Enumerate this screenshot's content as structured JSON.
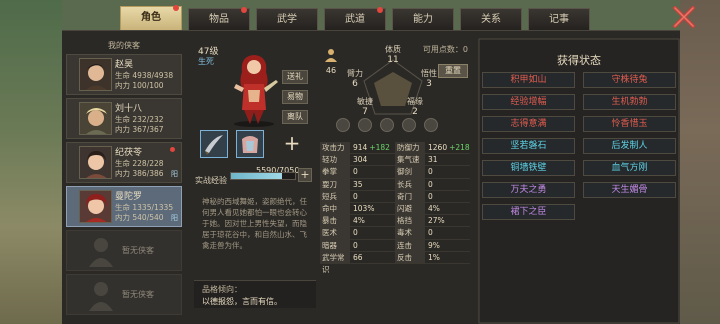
{
  "tabs": [
    {
      "label": "角色",
      "active": true,
      "badge": true
    },
    {
      "label": "物品",
      "active": false,
      "badge": true
    },
    {
      "label": "武学",
      "active": false,
      "badge": false
    },
    {
      "label": "武道",
      "active": false,
      "badge": true
    },
    {
      "label": "能力",
      "active": false,
      "badge": false
    },
    {
      "label": "关系",
      "active": false,
      "badge": false
    },
    {
      "label": "记事",
      "active": false,
      "badge": false
    }
  ],
  "character_list": {
    "title": "我的侠客",
    "characters": [
      {
        "name": "赵昊",
        "hp": "生命 4938/4938",
        "mp": "内力 100/100",
        "tag": ""
      },
      {
        "name": "刘十八",
        "hp": "生命 232/232",
        "mp": "内力 367/367",
        "tag": ""
      },
      {
        "name": "纪茯苓",
        "hp": "生命 228/228",
        "mp": "内力 386/386",
        "tag": "阳"
      },
      {
        "name": "曼陀罗",
        "hp": "生命 1335/1335",
        "mp": "内力 540/540",
        "tag": "阳"
      }
    ],
    "empty_slots": [
      "暂无侠客",
      "暂无侠客"
    ]
  },
  "profile": {
    "level": "47级",
    "gender": "生死",
    "buttons": [
      "送礼",
      "易物",
      "离队"
    ],
    "exp_label": "实战经验",
    "exp_value": "5590/7050",
    "exp_progress": 0.793,
    "exp_plus": "+",
    "equip_plus": "+",
    "bio": "神秘的西域舞姬，姿颜绝代，任何男人看见她都怕一眼也会转心于她。因对世上男性失望，而隐居于琼花谷中，和自然山水、飞禽走兽为伴。",
    "trait_title": "品格倾向：",
    "trait_text": "以德报怨，言而有信。"
  },
  "attributes": {
    "meditate_value": "46",
    "free_points_label": "可用点数：",
    "free_points": "0",
    "reset": "重置",
    "items": [
      {
        "name": "体质",
        "value": "11"
      },
      {
        "name": "臂力",
        "value": "6"
      },
      {
        "name": "悟性",
        "value": "3"
      },
      {
        "name": "敏捷",
        "value": "7"
      },
      {
        "name": "福缘",
        "value": "2"
      }
    ]
  },
  "stats": [
    [
      {
        "name": "攻击力",
        "value": "914",
        "bonus": "+182"
      },
      {
        "name": "防御力",
        "value": "1260",
        "bonus": "+218"
      }
    ],
    [
      {
        "name": "轻功",
        "value": "304",
        "bonus": ""
      },
      {
        "name": "集气速度",
        "value": "31",
        "bonus": ""
      }
    ],
    [
      {
        "name": "拳掌",
        "value": "0",
        "bonus": ""
      },
      {
        "name": "御剑",
        "value": "0",
        "bonus": ""
      }
    ],
    [
      {
        "name": "耍刀",
        "value": "35",
        "bonus": ""
      },
      {
        "name": "长兵",
        "value": "0",
        "bonus": ""
      }
    ],
    [
      {
        "name": "短兵",
        "value": "0",
        "bonus": ""
      },
      {
        "name": "奇门",
        "value": "0",
        "bonus": ""
      }
    ],
    [
      {
        "name": "命中",
        "value": "103%",
        "bonus": ""
      },
      {
        "name": "闪避",
        "value": "4%",
        "bonus": ""
      }
    ],
    [
      {
        "name": "暴击",
        "value": "4%",
        "bonus": ""
      },
      {
        "name": "格挡",
        "value": "27%",
        "bonus": ""
      }
    ],
    [
      {
        "name": "医术",
        "value": "0",
        "bonus": ""
      },
      {
        "name": "毒术",
        "value": "0",
        "bonus": ""
      }
    ],
    [
      {
        "name": "暗器",
        "value": "0",
        "bonus": ""
      },
      {
        "name": "连击",
        "value": "9%",
        "bonus": ""
      }
    ],
    [
      {
        "name": "武学常识",
        "value": "66",
        "bonus": ""
      },
      {
        "name": "反击",
        "value": "1%",
        "bonus": ""
      }
    ]
  ],
  "status": {
    "title": "获得状态",
    "items": [
      {
        "label": "积甲如山",
        "color": "red"
      },
      {
        "label": "守株待兔",
        "color": "red"
      },
      {
        "label": "经验增幅",
        "color": "red"
      },
      {
        "label": "生机勃勃",
        "color": "red"
      },
      {
        "label": "志得意满",
        "color": "red"
      },
      {
        "label": "怜香惜玉",
        "color": "red"
      },
      {
        "label": "坚若磐石",
        "color": "cyan"
      },
      {
        "label": "后发制人",
        "color": "cyan"
      },
      {
        "label": "铜墙铁壁",
        "color": "cyan"
      },
      {
        "label": "血气方刚",
        "color": "cyan"
      },
      {
        "label": "万夫之勇",
        "color": "purple"
      },
      {
        "label": "天生媚骨",
        "color": "purple"
      },
      {
        "label": "裙下之臣",
        "color": "purple"
      }
    ]
  }
}
